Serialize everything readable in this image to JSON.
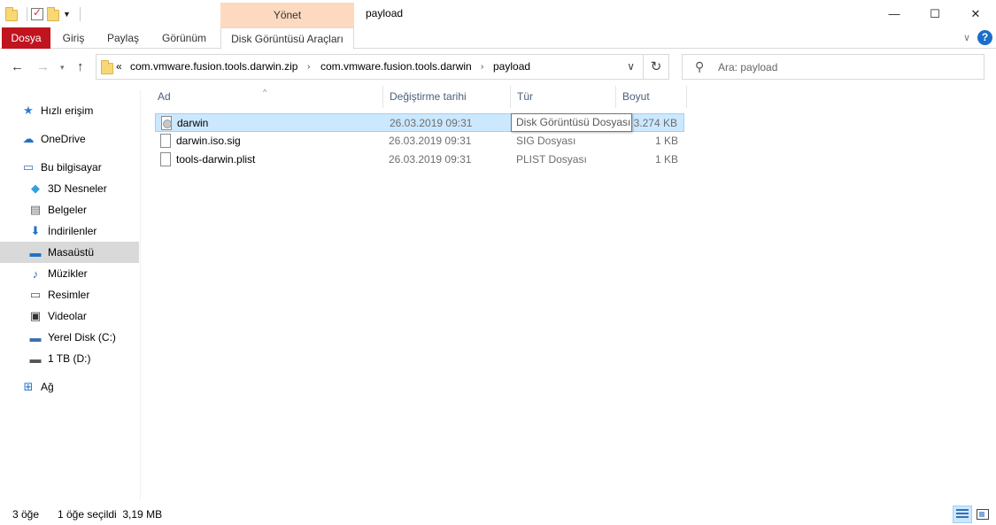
{
  "window": {
    "title": "payload",
    "manage_tab": "Yönet",
    "minimize": "—",
    "maximize": "☐",
    "close": "✕"
  },
  "ribbon": {
    "tabs": [
      "Dosya",
      "Giriş",
      "Paylaş",
      "Görünüm",
      "Disk Görüntüsü Araçları"
    ],
    "file_color": "#c0141f",
    "help": "?"
  },
  "address": {
    "overflow": "«",
    "crumbs": [
      "com.vmware.fusion.tools.darwin.zip",
      "com.vmware.fusion.tools.darwin",
      "payload"
    ],
    "search_placeholder": "Ara: payload"
  },
  "sidebar": {
    "items": [
      {
        "label": "Hızlı erişim",
        "icon": "star-icon"
      },
      {
        "label": "OneDrive",
        "icon": "cloud-icon"
      },
      {
        "label": "Bu bilgisayar",
        "icon": "computer-icon"
      },
      {
        "label": "3D Nesneler",
        "icon": "cube-icon"
      },
      {
        "label": "Belgeler",
        "icon": "document-icon"
      },
      {
        "label": "İndirilenler",
        "icon": "download-icon"
      },
      {
        "label": "Masaüstü",
        "icon": "desktop-icon"
      },
      {
        "label": "Müzikler",
        "icon": "music-icon"
      },
      {
        "label": "Resimler",
        "icon": "pictures-icon"
      },
      {
        "label": "Videolar",
        "icon": "video-icon"
      },
      {
        "label": "Yerel Disk (C:)",
        "icon": "drive-icon"
      },
      {
        "label": "1 TB (D:)",
        "icon": "drive-icon"
      },
      {
        "label": "Ağ",
        "icon": "network-icon"
      }
    ],
    "selected": "Masaüstü"
  },
  "columns": {
    "name": "Ad",
    "date": "Değiştirme tarihi",
    "type": "Tür",
    "size": "Boyut"
  },
  "files": [
    {
      "name": "darwin",
      "date": "26.03.2019 09:31",
      "type": "Disk Görüntüsü Dosyası",
      "size": "3.274 KB",
      "icon": "disc-image-icon",
      "selected": true
    },
    {
      "name": "darwin.iso.sig",
      "date": "26.03.2019 09:31",
      "type": "SIG Dosyası",
      "size": "1 KB",
      "icon": "file-icon",
      "selected": false
    },
    {
      "name": "tools-darwin.plist",
      "date": "26.03.2019 09:31",
      "type": "PLIST Dosyası",
      "size": "1 KB",
      "icon": "file-icon",
      "selected": false
    }
  ],
  "tooltip": "Disk Görüntüsü Dosyası",
  "status": {
    "count": "3 öğe",
    "selection": "1 öğe seçildi  3,19 MB"
  },
  "colors": {
    "selection_bg": "#cce8ff",
    "selection_border": "#99d1ff",
    "manage_tab_bg": "#fdd9c0",
    "sidebar_selected": "#d9d9d9"
  }
}
